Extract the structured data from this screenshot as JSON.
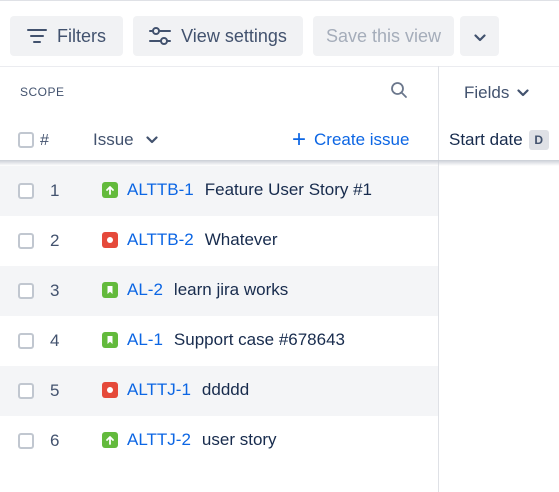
{
  "toolbar": {
    "filters_label": "Filters",
    "view_settings_label": "View settings",
    "save_view_label": "Save this view"
  },
  "scope": {
    "label": "SCOPE",
    "fields_label": "Fields",
    "columns": {
      "number": "#",
      "issue": "Issue",
      "create_issue": "Create issue",
      "start_date": "Start date",
      "start_date_badge": "D"
    }
  },
  "issue_type_colors": {
    "story": "#63ba3c",
    "bug": "#e5493a",
    "support": "#63ba3c"
  },
  "issues": [
    {
      "num": "1",
      "key": "ALTTB-1",
      "summary": "Feature User Story #1",
      "type": "story",
      "icon": "story-arrow-icon"
    },
    {
      "num": "2",
      "key": "ALTTB-2",
      "summary": "Whatever",
      "type": "bug",
      "icon": "bug-dot-icon"
    },
    {
      "num": "3",
      "key": "AL-2",
      "summary": "learn jira works",
      "type": "support",
      "icon": "bookmark-icon"
    },
    {
      "num": "4",
      "key": "AL-1",
      "summary": "Support case #678643",
      "type": "support",
      "icon": "bookmark-icon"
    },
    {
      "num": "5",
      "key": "ALTTJ-1",
      "summary": "ddddd",
      "type": "bug",
      "icon": "bug-dot-icon"
    },
    {
      "num": "6",
      "key": "ALTTJ-2",
      "summary": "user story",
      "type": "story",
      "icon": "story-arrow-icon"
    }
  ]
}
